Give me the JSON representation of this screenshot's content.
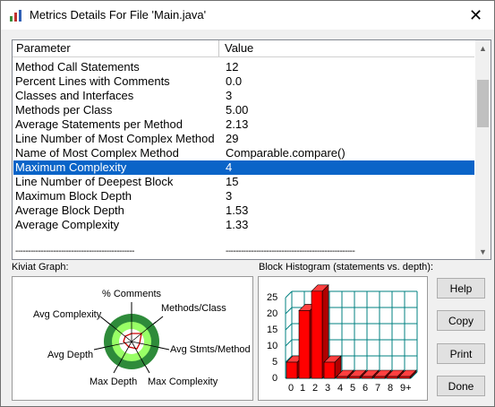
{
  "window": {
    "title": "Metrics Details For File 'Main.java'"
  },
  "table": {
    "headers": {
      "parameter": "Parameter",
      "value": "Value"
    },
    "rows": [
      {
        "parameter": "Method Call Statements",
        "value": "12"
      },
      {
        "parameter": "Percent Lines with Comments",
        "value": "0.0"
      },
      {
        "parameter": "Classes and Interfaces",
        "value": "3"
      },
      {
        "parameter": "Methods per Class",
        "value": "5.00"
      },
      {
        "parameter": "Average Statements per Method",
        "value": "2.13"
      },
      {
        "parameter": "Line Number of Most Complex Method",
        "value": "29"
      },
      {
        "parameter": "Name of Most Complex Method",
        "value": "Comparable.compare()"
      },
      {
        "parameter": "Maximum Complexity",
        "value": "4",
        "selected": true
      },
      {
        "parameter": "Line Number of Deepest Block",
        "value": "15"
      },
      {
        "parameter": "Maximum Block Depth",
        "value": "3"
      },
      {
        "parameter": "Average Block Depth",
        "value": "1.53"
      },
      {
        "parameter": "Average Complexity",
        "value": "1.33"
      }
    ],
    "separator_left": "-----------------------------------------------",
    "separator_right": "---------------------------------------------------"
  },
  "kiviat": {
    "label": "Kiviat Graph:",
    "axes": [
      "% Comments",
      "Methods/Class",
      "Avg Stmts/Method",
      "Max Complexity",
      "Max Depth",
      "Avg Depth",
      "Avg Complexity"
    ]
  },
  "histogram": {
    "label": "Block Histogram (statements vs. depth):",
    "y_ticks": [
      "25",
      "20",
      "15",
      "10",
      "5",
      "0"
    ],
    "x_labels": [
      "0",
      "1",
      "2",
      "3",
      "4",
      "5",
      "6",
      "7",
      "8",
      "9+"
    ]
  },
  "chart_data": {
    "type": "bar",
    "categories": [
      "0",
      "1",
      "2",
      "3",
      "4",
      "5",
      "6",
      "7",
      "8",
      "9+"
    ],
    "values": [
      5,
      21,
      27,
      5,
      0,
      0,
      0,
      0,
      0,
      0
    ],
    "title": "Block Histogram (statements vs. depth):",
    "ylim": [
      0,
      27
    ],
    "grid": true,
    "bar_color": "#ff0000"
  },
  "buttons": {
    "help": "Help",
    "copy": "Copy",
    "print": "Print",
    "done": "Done"
  },
  "colors": {
    "selection": "#0a64c8",
    "kiviat_fill": "#99ff66",
    "bar": "#ff0000",
    "grid": "#008080"
  }
}
